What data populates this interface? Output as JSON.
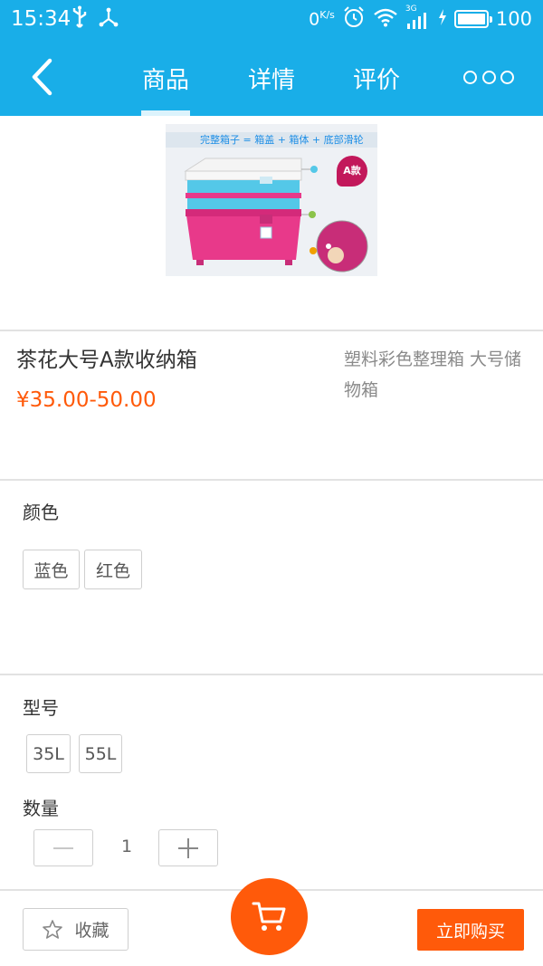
{
  "status_bar": {
    "time": "15:34",
    "net_speed": "0",
    "net_speed_unit": "K/s",
    "network": "3G",
    "battery": "100"
  },
  "nav": {
    "back_icon": "chevron-left-icon",
    "tabs": [
      {
        "label": "商品",
        "active": true
      },
      {
        "label": "详情",
        "active": false
      },
      {
        "label": "评价",
        "active": false
      }
    ],
    "more_icon": "more-dots-icon"
  },
  "product": {
    "image_banner": "完整箱子 = 箱盖 + 箱体 + 底部滑轮",
    "image_badge": "A款",
    "title": "茶花大号A款收纳箱",
    "price": "¥35.00-50.00",
    "subtitle": "塑料彩色整理箱 大号储物箱"
  },
  "color_section": {
    "label": "颜色",
    "options": [
      "蓝色",
      "红色"
    ]
  },
  "model_section": {
    "label": "型号",
    "options": [
      "35L",
      "55L"
    ]
  },
  "quantity_section": {
    "label": "数量",
    "value": "1"
  },
  "bottom_bar": {
    "favorite_label": "收藏",
    "buy_label": "立即购买"
  },
  "colors": {
    "brand_blue": "#19aee8",
    "accent_orange": "#ff5a0a",
    "box_pink": "#e8398a",
    "box_cyan": "#54c8e8"
  }
}
